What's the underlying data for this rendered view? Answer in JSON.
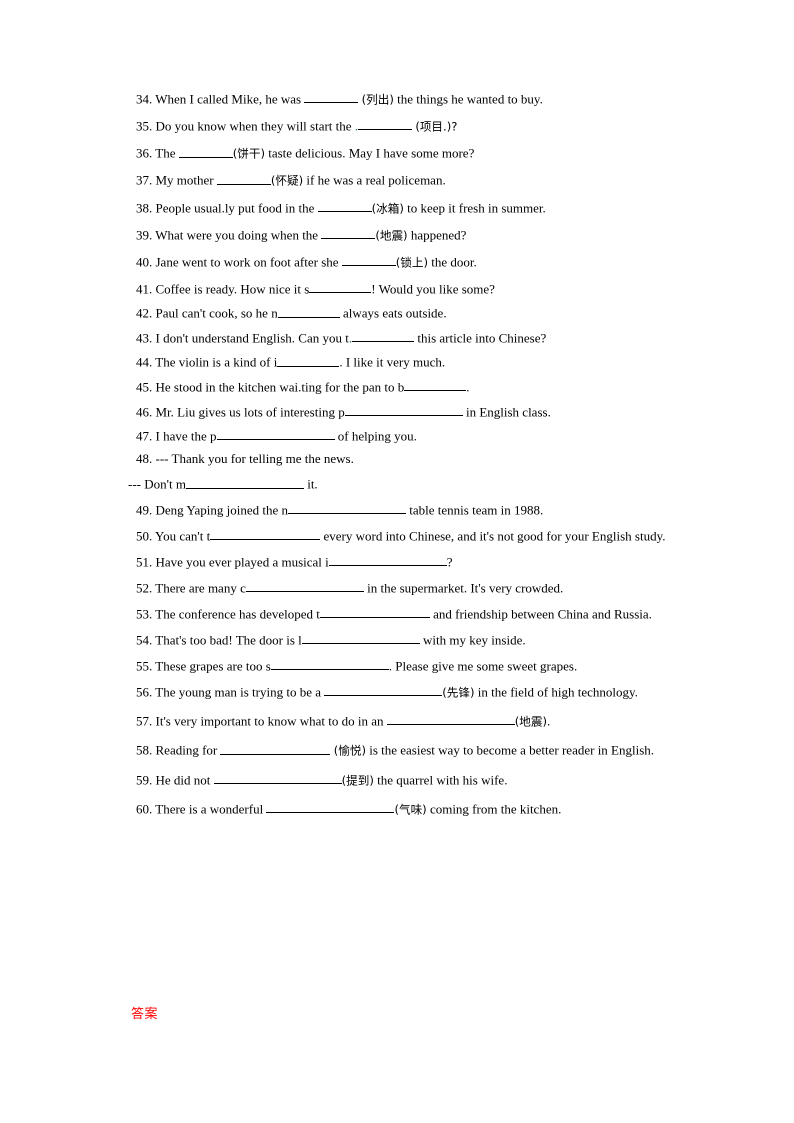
{
  "document": {
    "type": "worksheet",
    "language": "en-zh",
    "answer_key_label": "答案",
    "answer_key_color": "#ff0000",
    "background_color": "#ffffff",
    "text_color": "#000000"
  },
  "questions": [
    {
      "number": "34.",
      "pre": "When I called Mike, he was ",
      "blank": "short",
      "hint": "(列出)",
      "post": " the things he wanted to buy."
    },
    {
      "number": "35.",
      "pre": "Do you know when they will start the ",
      "blank": "short",
      "artifact": ".",
      "hint": "(项目.)?",
      "post": ""
    },
    {
      "number": "36.",
      "pre": "The ",
      "blank": "short",
      "hint": "(饼干)",
      "post": " taste delicious. May I have some more?"
    },
    {
      "number": "37.",
      "pre": "My mother ",
      "blank": "short",
      "hint": "(怀疑)",
      "post": " if he was a real policeman."
    },
    {
      "number": "38.",
      "pre": "People usual.ly put food in the ",
      "blank": "short",
      "hint": "(冰箱)",
      "post": " to keep it fresh in summer."
    },
    {
      "number": "39.",
      "pre": "What were you doing when the ",
      "blank": "short",
      "hint": "(地震)",
      "post": " happened?"
    },
    {
      "number": "40.",
      "pre": "Jane went to work on foot after she ",
      "blank": "short",
      "hint": "(锁上)",
      "post": " the door."
    },
    {
      "number": "41.",
      "pre": "Coffee is ready. How nice it s",
      "blank": "short",
      "hint": "",
      "post": "! Would you like some?"
    },
    {
      "number": "42.",
      "pre": "Paul can't cook, so he n",
      "blank": "short",
      "hint": "",
      "post": " always eats outside."
    },
    {
      "number": "43.",
      "pre": "I don't understand English. Can you t",
      "blank": "short",
      "artifact": ".",
      "hint": "",
      "post": " this article into Chinese?"
    },
    {
      "number": "44.",
      "pre": "The violin is a kind of i",
      "blank": "short",
      "hint": "",
      "post": ". I like it very much."
    },
    {
      "number": "45.",
      "pre": "He stood in the kitchen wai.ting for the pan to b",
      "blank": "short",
      "hint": "",
      "post": "."
    },
    {
      "number": "46.",
      "pre": "Mr. Liu gives us lots of interesting p",
      "blank": "xlarge",
      "hint": "",
      "post": " in English class."
    },
    {
      "number": "47.",
      "pre": "I have the p",
      "blank": "xlarge",
      "hint": "",
      "post": " of helping you."
    },
    {
      "number": "48.",
      "pre": "--- Thank you for telling me the news.",
      "blank": "none",
      "hint": "",
      "post": "",
      "continuation": {
        "pre": "--- Don't m",
        "blank": "xlarge",
        "post": " it."
      }
    },
    {
      "number": "49.",
      "pre": "Deng Yaping joined the n",
      "blank": "xlarge",
      "hint": "",
      "post": " table tennis team in 1988."
    },
    {
      "number": "50.",
      "pre": "You can't t",
      "blank": "large",
      "hint": "",
      "post": " every word into Chinese, and it's not good for your English study."
    },
    {
      "number": "51.",
      "pre": "Have you ever played a musical i",
      "blank": "xlarge",
      "hint": "",
      "post": "?"
    },
    {
      "number": "52.",
      "pre": "There are many c",
      "blank": "xlarge",
      "hint": "",
      "post": " in the supermarket. It's very crowded."
    },
    {
      "number": "53.",
      "pre": "The conference has developed t",
      "blank": "large",
      "hint": "",
      "post": " and friendship between China and Russia.",
      "justified": true
    },
    {
      "number": "54.",
      "pre": "That's too bad! The door is l",
      "blank": "xlarge",
      "hint": "",
      "post": " with my key inside."
    },
    {
      "number": "55.",
      "pre": "These grapes are too s",
      "blank": "xlarge",
      "hint": "",
      "post": ". Please give me some sweet grapes."
    },
    {
      "number": "56.",
      "pre": "The young man is trying to be a ",
      "blank": "xlarge",
      "hint": "(先锋)",
      "post": " in the field of high technology."
    },
    {
      "number": "57.",
      "pre": "It's very important to know what to do in an ",
      "blank": "xlarge",
      "hint": "(地震)",
      "post": "."
    },
    {
      "number": "58.",
      "pre": "Reading for ",
      "blank": "large",
      "hint": "(愉悦)",
      "post": " is the easiest way to become a better reader in English.",
      "justified": true
    },
    {
      "number": "59.",
      "pre": "He did not ",
      "blank": "xlarge",
      "hint": "(提到)",
      "post": " the quarrel with his wife."
    },
    {
      "number": "60.",
      "pre": "There is a wonderful ",
      "blank": "xlarge",
      "hint": "(气味)",
      "post": " coming from the kitchen."
    }
  ]
}
